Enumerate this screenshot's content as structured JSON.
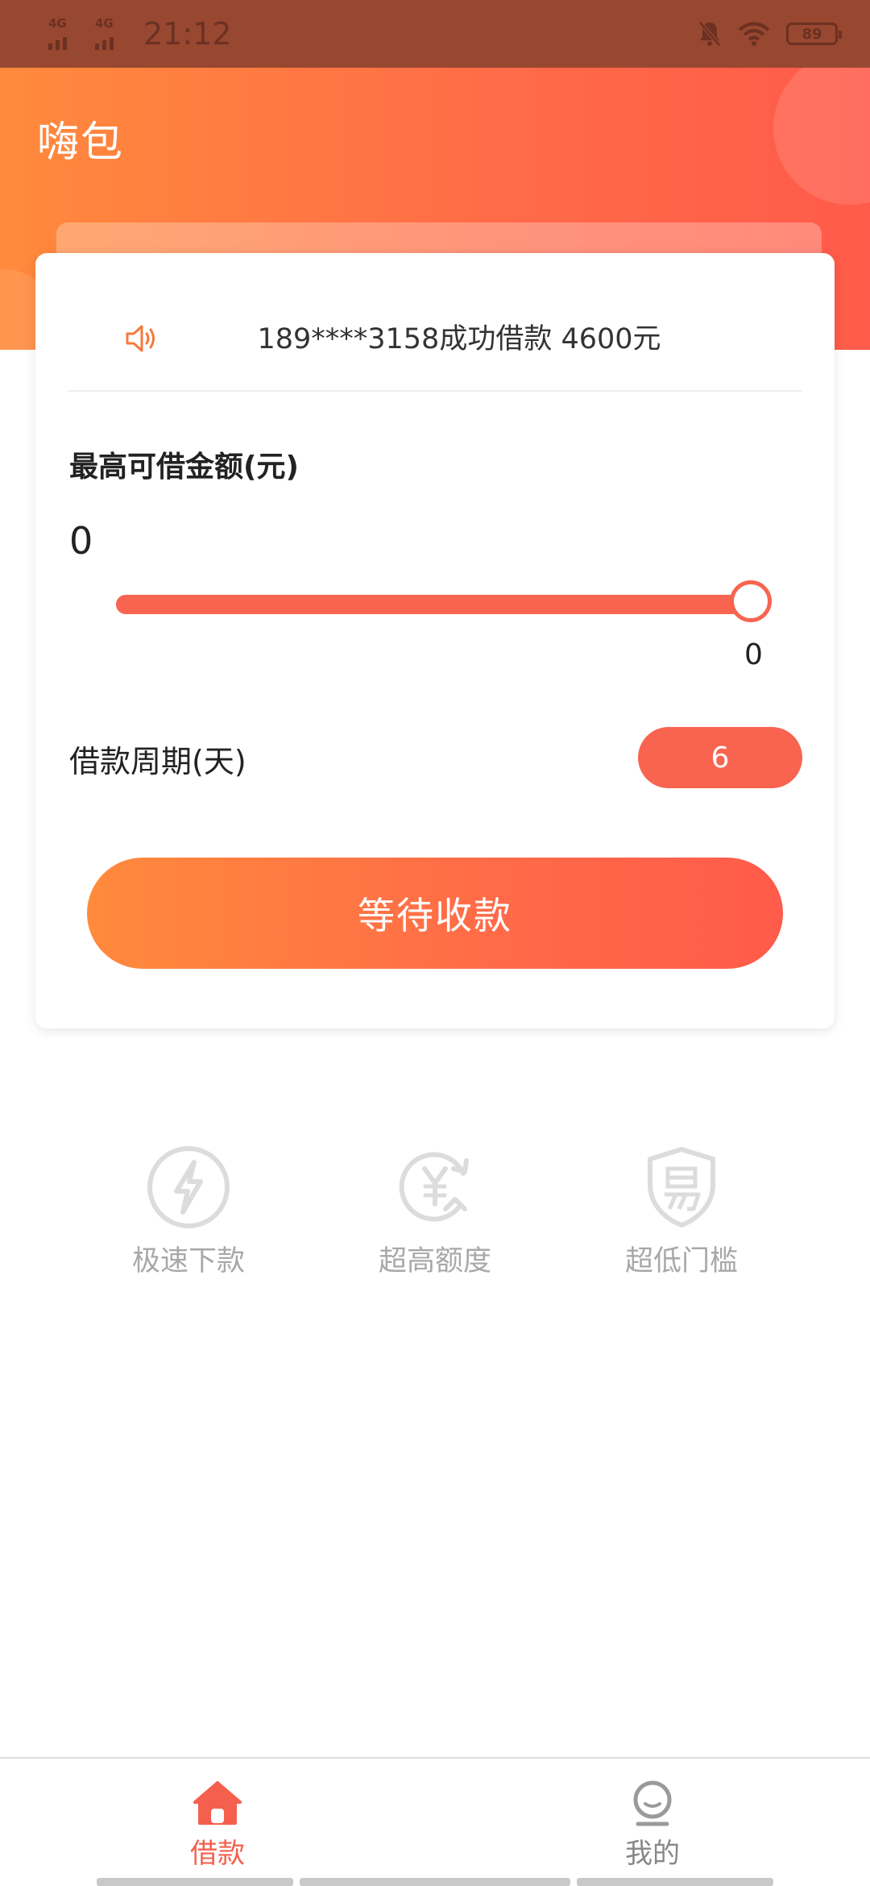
{
  "status_bar": {
    "network_1": "4G",
    "network_2": "4G",
    "time": "21:12",
    "battery": "89",
    "icons": [
      "signal-icon",
      "signal-icon",
      "mute-icon",
      "wifi-icon",
      "battery-icon"
    ]
  },
  "header": {
    "title": "嗨包"
  },
  "notice": {
    "icon": "speaker-icon",
    "text": "189****3158成功借款 4600元"
  },
  "loan": {
    "limit_label": "最高可借金额(元)",
    "min_value": "0",
    "max_value": "0",
    "slider_position": 1.0,
    "period_label": "借款周期(天)",
    "period_value": "6",
    "action_label": "等待收款"
  },
  "features": [
    {
      "icon": "lightning-icon",
      "label": "极速下款"
    },
    {
      "icon": "yuan-arrow-icon",
      "label": "超高额度"
    },
    {
      "icon": "shield-yi-icon",
      "label": "超低门槛"
    }
  ],
  "nav": {
    "items": [
      {
        "icon": "home-icon",
        "label": "借款",
        "active": true
      },
      {
        "icon": "user-icon",
        "label": "我的",
        "active": false
      }
    ]
  },
  "colors": {
    "brand": "#f86450",
    "gradient_start": "#ff8a3c",
    "gradient_end": "#ff5b4a",
    "status_bar": "#984730",
    "muted_text": "#a8a8a8"
  }
}
